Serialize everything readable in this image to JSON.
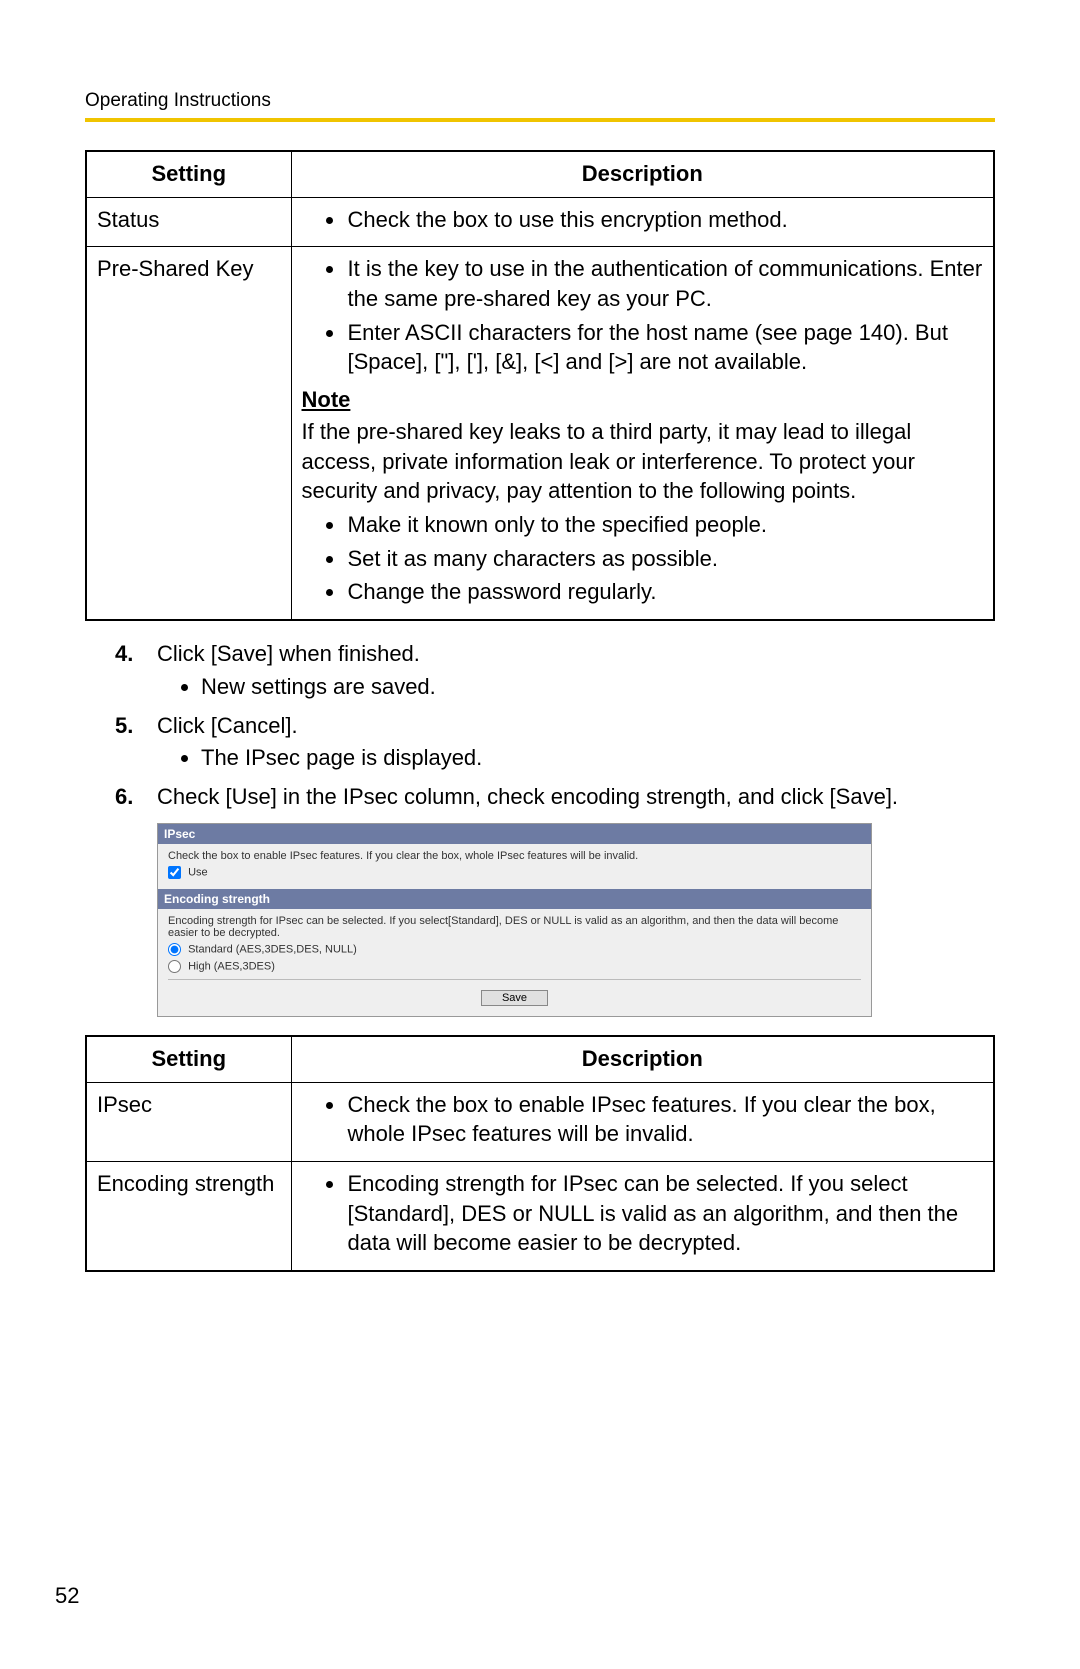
{
  "header": "Operating Instructions",
  "table1": {
    "head_setting": "Setting",
    "head_desc": "Description",
    "rows": [
      {
        "setting": "Status",
        "bullets": [
          "Check the box to use this encryption method."
        ]
      },
      {
        "setting": "Pre-Shared Key",
        "bullets": [
          "It is the key to use in the authentication of communications. Enter the same pre-shared key as your PC.",
          "Enter ASCII characters for the host name (see page 140). But [Space], [\"], ['], [&], [<] and [>] are not available."
        ],
        "note_label": "Note",
        "note_text": "If the pre-shared key leaks to a third party, it may lead to illegal access, private information leak or interference. To protect your security and privacy, pay attention to the following points.",
        "note_bullets": [
          "Make it known only to the specified people.",
          "Set it as many characters as possible.",
          "Change the password regularly."
        ]
      }
    ]
  },
  "steps": [
    {
      "num": "4.",
      "text": "Click [Save] when finished.",
      "sub": [
        "New settings are saved."
      ]
    },
    {
      "num": "5.",
      "text": "Click [Cancel].",
      "sub": [
        "The IPsec page is displayed."
      ]
    },
    {
      "num": "6.",
      "text": "Check [Use] in the IPsec column, check encoding strength, and click [Save].",
      "sub": []
    }
  ],
  "screenshot": {
    "bar1": "IPsec",
    "ipsec_text": "Check the box to enable IPsec features. If you clear the box, whole IPsec features will be invalid.",
    "use_label": "Use",
    "bar2": "Encoding strength",
    "enc_text": "Encoding strength for IPsec can be selected. If you select[Standard], DES or NULL is valid as an algorithm, and then the data will become easier to be decrypted.",
    "opt_standard": "Standard (AES,3DES,DES, NULL)",
    "opt_high": "High (AES,3DES)",
    "save_btn": "Save"
  },
  "table2": {
    "head_setting": "Setting",
    "head_desc": "Description",
    "rows": [
      {
        "setting": "IPsec",
        "bullets": [
          "Check the box to enable IPsec features. If you clear the box, whole IPsec features will be invalid."
        ]
      },
      {
        "setting": "Encoding strength",
        "bullets": [
          "Encoding strength for IPsec can be selected. If you select [Standard], DES or NULL is valid as an algorithm, and then the data will become easier to be decrypted."
        ]
      }
    ]
  },
  "page_number": "52"
}
